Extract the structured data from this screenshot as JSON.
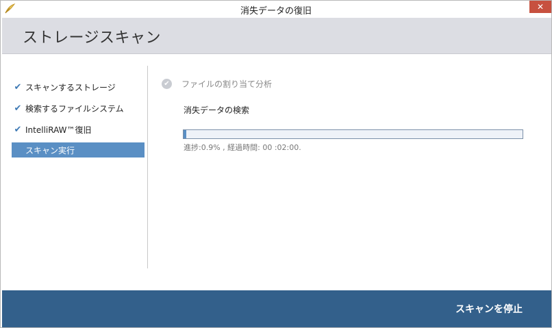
{
  "window": {
    "title": "消失データの復旧",
    "close_label": "✕"
  },
  "header": {
    "title": "ストレージスキャン"
  },
  "sidebar": {
    "steps": [
      {
        "label": "スキャンするストレージ",
        "done": true
      },
      {
        "label": "検索するファイルシステム",
        "done": true
      },
      {
        "label": "IntelliRAW™復旧",
        "done": true
      },
      {
        "label": "スキャン実行",
        "active": true
      }
    ],
    "check_glyph": "✔"
  },
  "main": {
    "phase_label": "ファイルの割り当て分析",
    "phase_icon_glyph": "✔",
    "subtask": "消失データの検索",
    "progress": {
      "fraction": 0.009,
      "label_progress": "進捗",
      "percent_text": ":0.9%",
      "label_elapsed": "経過時間",
      "elapsed_text": ": 00 :02:00."
    }
  },
  "footer": {
    "stop_label": "スキャンを停止"
  },
  "colors": {
    "header_bg": "#dcdde3",
    "footer_bg": "#33608b",
    "active_step_bg": "#5a8fc4",
    "check_color": "#3c78b4",
    "close_button": "#c7503f"
  },
  "icons": {
    "app": "feather-icon",
    "close": "close-icon",
    "check": "check-icon",
    "phase": "check-circle-icon"
  }
}
